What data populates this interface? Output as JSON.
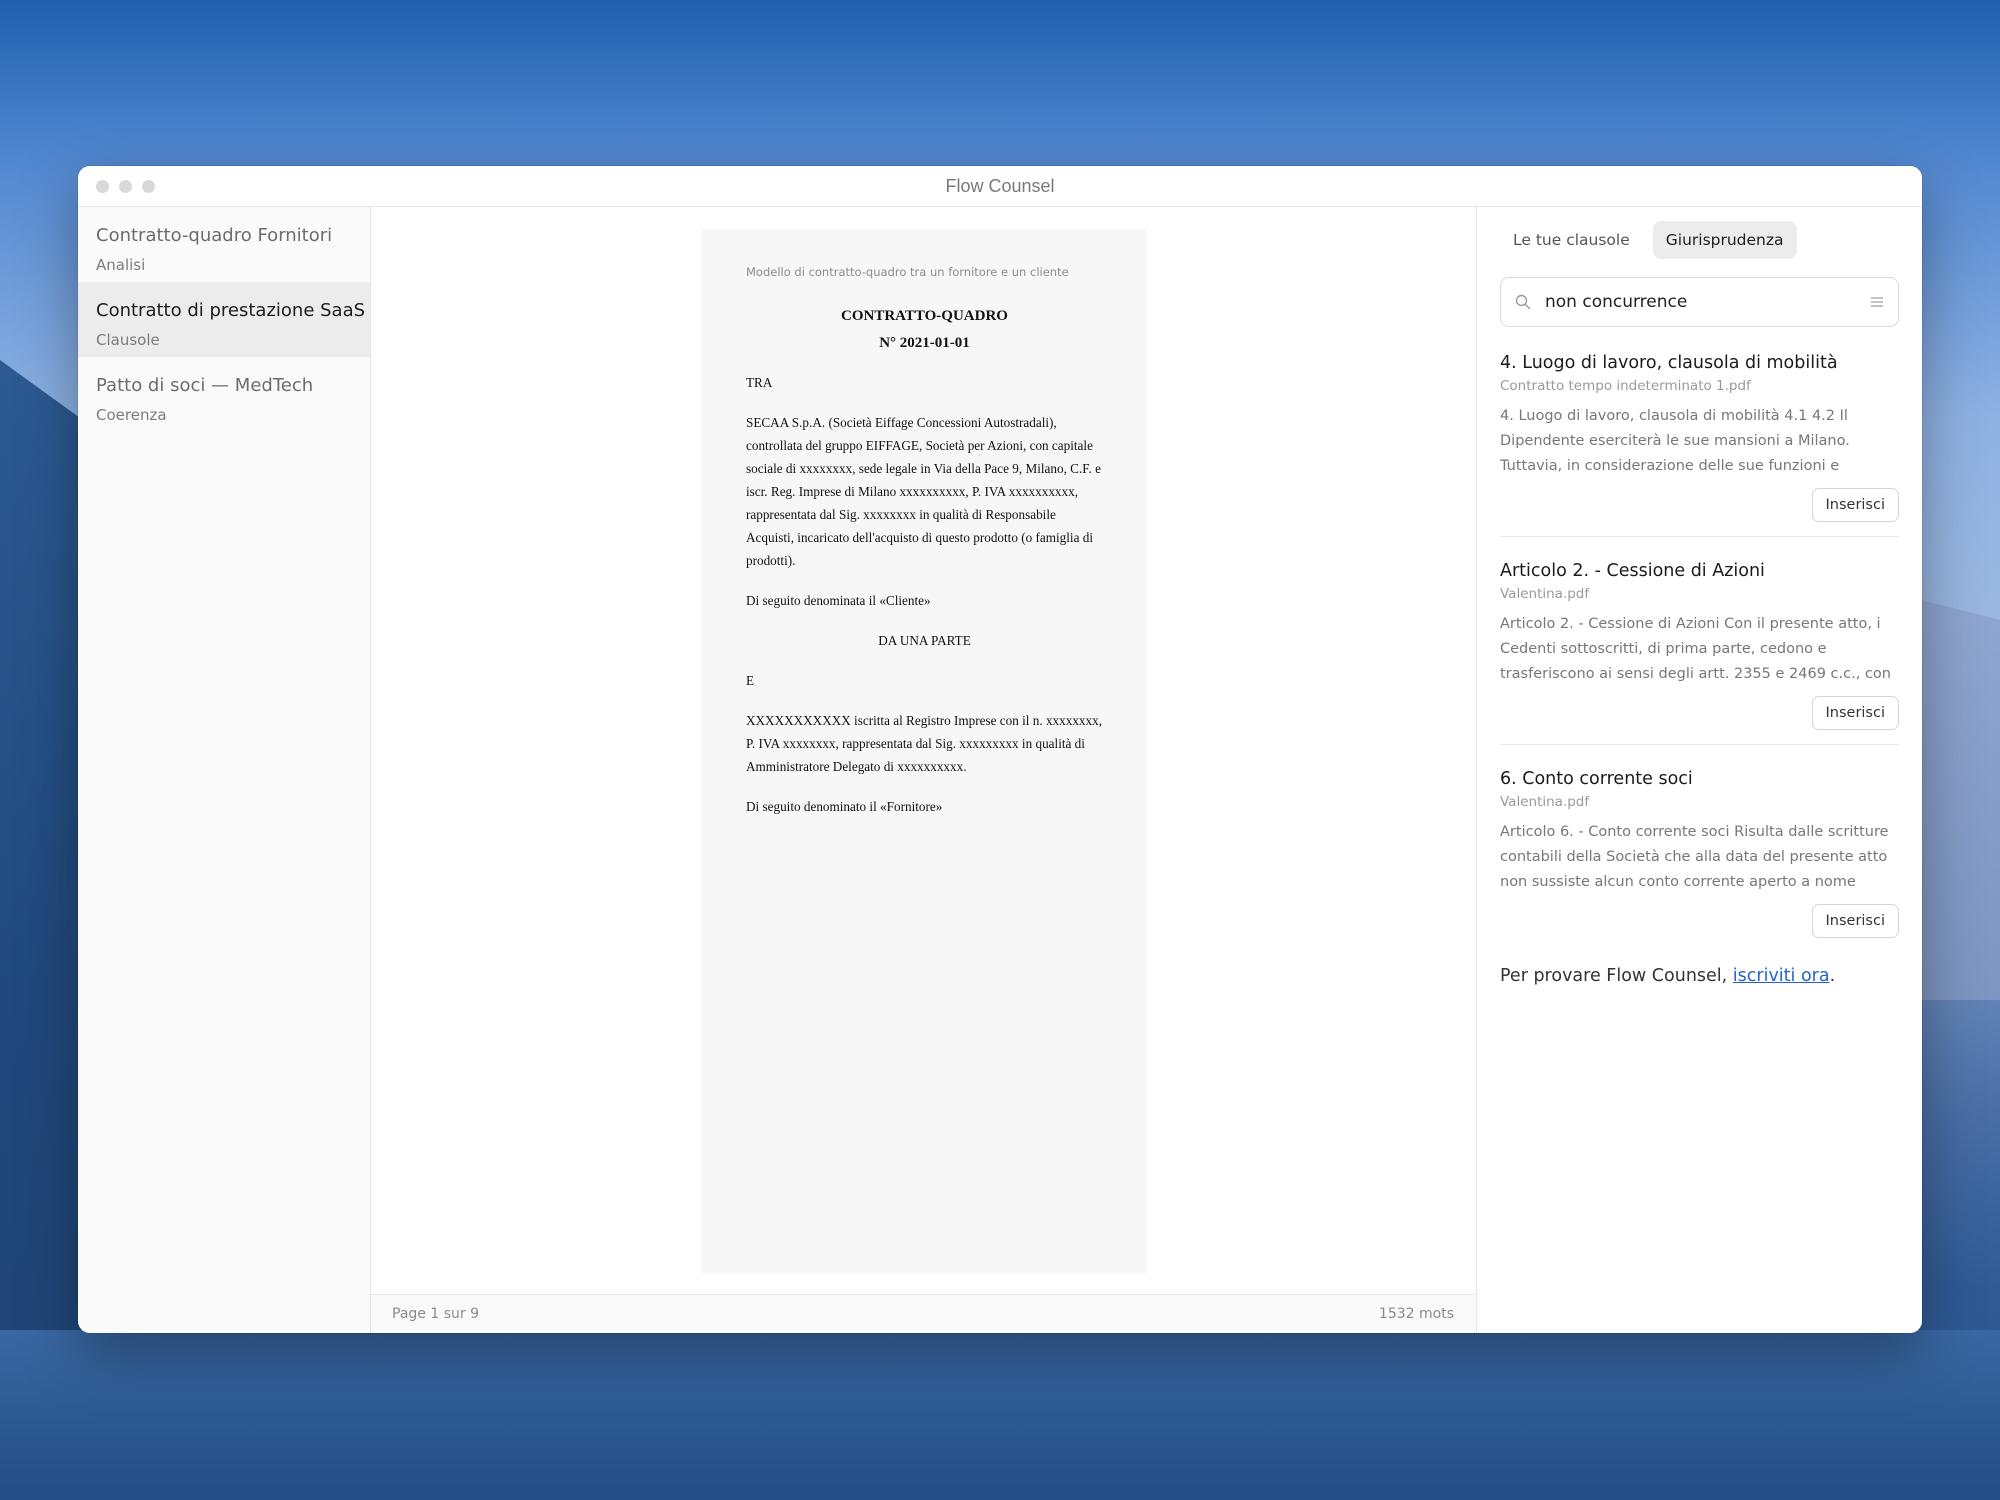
{
  "window": {
    "title": "Flow Counsel"
  },
  "sidebar": {
    "items": [
      {
        "title": "Contratto-quadro Fornitori",
        "subtitle": "Analisi",
        "active": false
      },
      {
        "title": "Contratto di prestazione SaaS",
        "subtitle": "Clausole",
        "active": true
      },
      {
        "title": "Patto di soci — MedTech",
        "subtitle": "Coerenza",
        "active": false
      }
    ]
  },
  "document": {
    "header": "Modello di contratto-quadro tra un fornitore e un cliente",
    "title_line1": "CONTRATTO-QUADRO",
    "title_line2": "N° 2021-01-01",
    "p1": "TRA",
    "p2": "SECAA S.p.A. (Società Eiffage Concessioni Autostradali), controllata del gruppo EIFFAGE, Società per Azioni, con capitale sociale di xxxxxxxx, sede legale in Via della Pace 9, Milano, C.F. e iscr. Reg. Imprese di Milano xxxxxxxxxx, P. IVA xxxxxxxxxx, rappresentata dal Sig. xxxxxxxx in qualità di Responsabile Acquisti, incaricato dell'acquisto di questo prodotto (o famiglia di prodotti).",
    "p3": "Di seguito denominata il «Cliente»",
    "p4": "DA UNA PARTE",
    "p5": "E",
    "p6": "XXXXXXXXXXX iscritta al Registro Imprese con il n. xxxxxxxx, P. IVA xxxxxxxx, rappresentata dal Sig. xxxxxxxxx in qualità di Amministratore Delegato di xxxxxxxxxx.",
    "p7": "Di seguito denominato il «Fornitore»"
  },
  "status": {
    "page": "Page 1 sur 9",
    "words": "1532 mots"
  },
  "panel": {
    "tabs": [
      "Le tue clausole",
      "Giurisprudenza"
    ],
    "active_tab": 1,
    "search": {
      "value": "non concurrence",
      "icon": "search-icon"
    },
    "results": [
      {
        "title": "4. Luogo di lavoro, clausola di mobilità",
        "file": "Contratto tempo indeterminato 1.pdf",
        "excerpt": "4. Luogo di lavoro, clausola di mobilità 4.1 4.2 Il Dipendente eserciterà le sue mansioni a Milano. Tuttavia, in considerazione delle sue funzioni e",
        "button": "Inserisci"
      },
      {
        "title": "Articolo 2. - Cessione di Azioni",
        "file": "Valentina.pdf",
        "excerpt": "Articolo 2. - Cessione di Azioni Con il presente atto, i Cedenti sottoscritti, di prima parte, cedono e trasferiscono ai sensi degli artt. 2355 e 2469 c.c., con",
        "button": "Inserisci"
      },
      {
        "title": "6. Conto corrente soci",
        "file": "Valentina.pdf",
        "excerpt": "Articolo 6. - Conto corrente soci Risulta dalle scritture contabili della Società che alla data del presente atto non sussiste alcun conto corrente aperto a nome",
        "button": "Inserisci"
      }
    ],
    "cta_prefix": "Per provare Flow Counsel, ",
    "cta_link": "iscriviti ora",
    "cta_suffix": "."
  },
  "colors": {
    "accent_link": "#2563c9",
    "active_item_bg": "#ececec"
  }
}
